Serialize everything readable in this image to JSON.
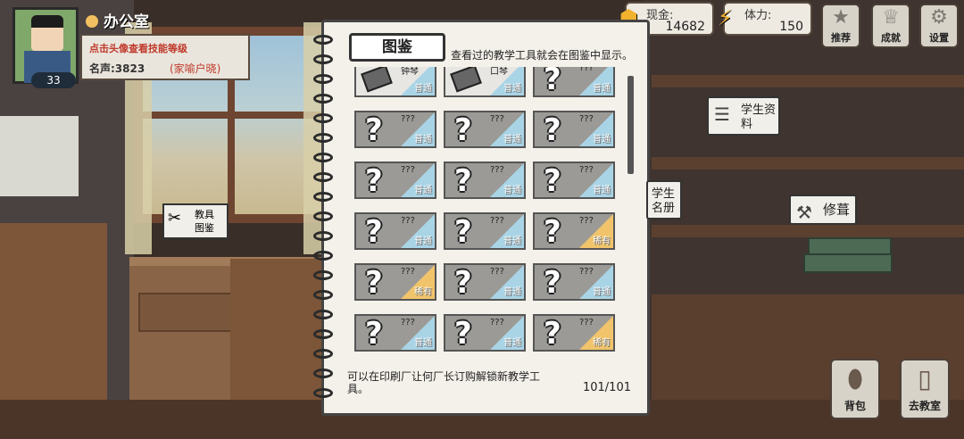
{
  "location": "办公室",
  "profile": {
    "level": "33",
    "hint": "点击头像查看技能等级",
    "fame": "名声:3823",
    "tag": "(家喻户晓)"
  },
  "stats": [
    {
      "label": "现金:",
      "value": "14682",
      "icon": "coin-icon"
    },
    {
      "label": "体力:",
      "value": "150",
      "icon": "lightning-icon"
    }
  ],
  "top_buttons": [
    {
      "label": "推荐",
      "icon": "star-icon"
    },
    {
      "label": "成就",
      "icon": "trophy-icon"
    },
    {
      "label": "设置",
      "icon": "gear-icon"
    }
  ],
  "notebook": {
    "title": "图鉴",
    "description": "查看过的教学工具就会在图鉴中显示。",
    "footer": "可以在印刷厂让何厂长订购解锁新教学工具。",
    "count": "101/101",
    "cards": [
      {
        "name": "钟琴",
        "rank": "普通",
        "known": true
      },
      {
        "name": "口琴",
        "rank": "普通",
        "known": true
      },
      {
        "name": "???",
        "rank": "普通",
        "known": false
      },
      {
        "name": "???",
        "rank": "普通",
        "known": false
      },
      {
        "name": "???",
        "rank": "普通",
        "known": false
      },
      {
        "name": "???",
        "rank": "普通",
        "known": false
      },
      {
        "name": "???",
        "rank": "普通",
        "known": false
      },
      {
        "name": "???",
        "rank": "普通",
        "known": false
      },
      {
        "name": "???",
        "rank": "普通",
        "known": false
      },
      {
        "name": "???",
        "rank": "普通",
        "known": false
      },
      {
        "name": "???",
        "rank": "普通",
        "known": false
      },
      {
        "name": "???",
        "rank": "稀有",
        "known": false
      },
      {
        "name": "???",
        "rank": "稀有",
        "known": false
      },
      {
        "name": "???",
        "rank": "普通",
        "known": false
      },
      {
        "name": "???",
        "rank": "普通",
        "known": false
      },
      {
        "name": "???",
        "rank": "普通",
        "known": false
      },
      {
        "name": "???",
        "rank": "普通",
        "known": false
      },
      {
        "name": "???",
        "rank": "稀有",
        "known": false
      }
    ]
  },
  "signs": {
    "tool_guide": "教具图鉴",
    "student_info": "学生资料",
    "student_roster": "学生名册",
    "repair": "修葺"
  },
  "bottom_buttons": [
    {
      "label": "背包",
      "icon": "bag-icon"
    },
    {
      "label": "去教室",
      "icon": "door-icon"
    }
  ]
}
